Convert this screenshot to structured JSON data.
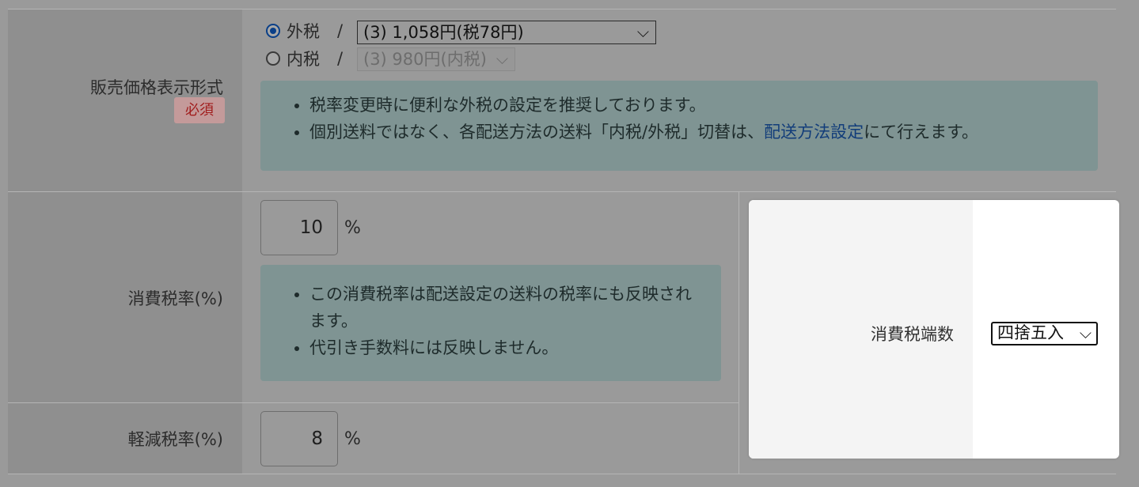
{
  "price_display": {
    "label": "販売価格表示形式",
    "required_badge": "必須",
    "option_exclusive": {
      "label": "外税",
      "selected": true,
      "slash": "/",
      "select_value": "(3) 1,058円(税78円)"
    },
    "option_inclusive": {
      "label": "内税",
      "selected": false,
      "slash": "/",
      "select_value": "(3) 980円(内税)"
    },
    "notes": [
      "税率変更時に便利な外税の設定を推奨しております。"
    ],
    "note2": {
      "before": "個別送料ではなく、各配送方法の送料「内税/外税」切替は、",
      "link": "配送方法設定",
      "after": "にて行えます。"
    }
  },
  "consumption_tax": {
    "label": "消費税率(%)",
    "value": "10",
    "unit": "%",
    "notes": [
      "この消費税率は配送設定の送料の税率にも反映されます。",
      "代引き手数料には反映しません。"
    ]
  },
  "reduced_tax": {
    "label": "軽減税率(%)",
    "value": "8",
    "unit": "%"
  },
  "modal": {
    "label": "消費税端数",
    "select_value": "四捨五入"
  },
  "icons": {
    "chevron": "chevron-down-icon"
  },
  "colors": {
    "link": "#1f5fb8",
    "required": "#c0392b",
    "radio_checked": "#0b57d0"
  }
}
